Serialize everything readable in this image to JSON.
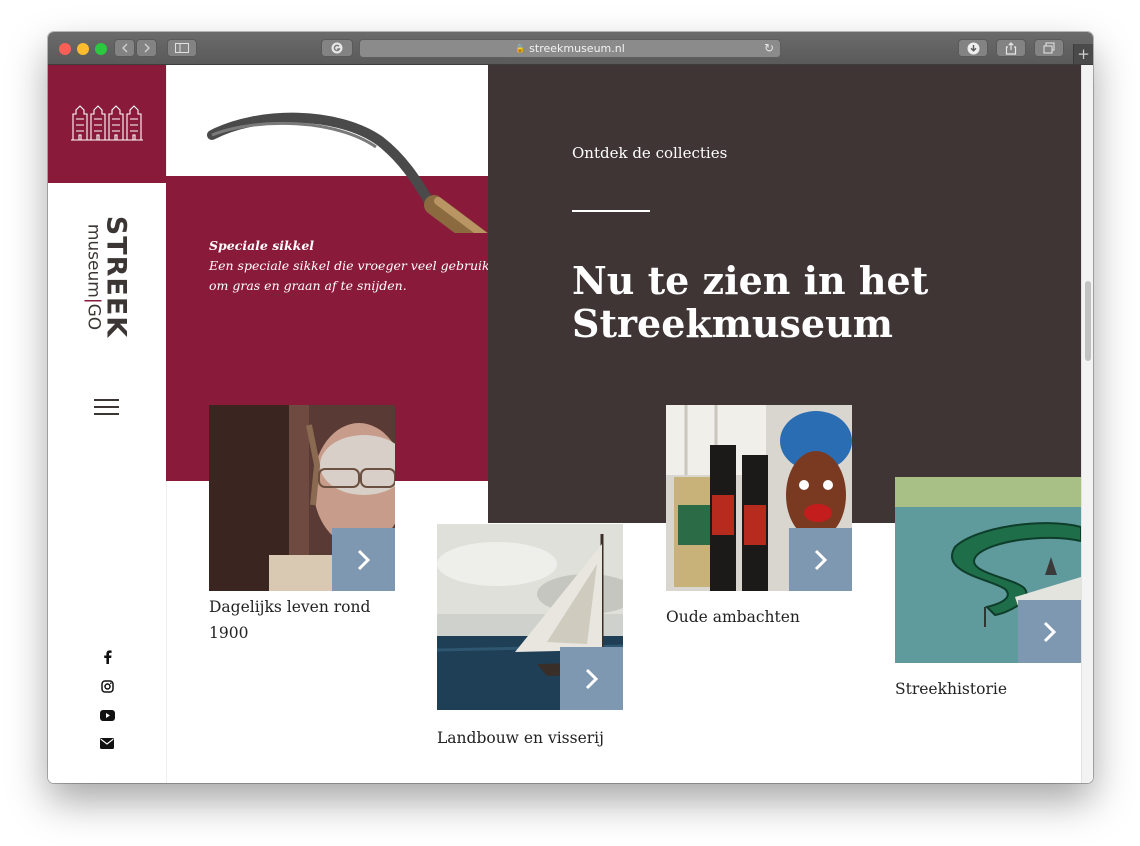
{
  "browser": {
    "url": "streekmuseum.nl"
  },
  "sidebar": {
    "logo_big": "STREEK",
    "logo_small_a": "museum",
    "logo_small_sep": "|",
    "logo_small_b": "GO"
  },
  "hero": {
    "caption_title": "Speciale sikkel",
    "caption_line1": "Een speciale sikkel die vroeger veel gebruikt we",
    "caption_line2": "om gras en graan af te snijden.",
    "eyebrow": "Ontdek de collecties",
    "headline_line1": "Nu te zien in het",
    "headline_line2": "Streekmuseum"
  },
  "cards": [
    {
      "label_line1": "Dagelijks leven rond",
      "label_line2": "1900"
    },
    {
      "label_line1": "Landbouw en visserij",
      "label_line2": ""
    },
    {
      "label_line1": "Oude ambachten",
      "label_line2": ""
    },
    {
      "label_line1": "Streekhistorie",
      "label_line2": ""
    }
  ],
  "colors": {
    "brand_crimson": "#8a1a3a",
    "brand_dark": "#3f3535",
    "arrow_blue": "#7f98b2"
  },
  "icons": {
    "social": [
      "facebook-icon",
      "instagram-icon",
      "youtube-icon",
      "email-icon"
    ]
  }
}
